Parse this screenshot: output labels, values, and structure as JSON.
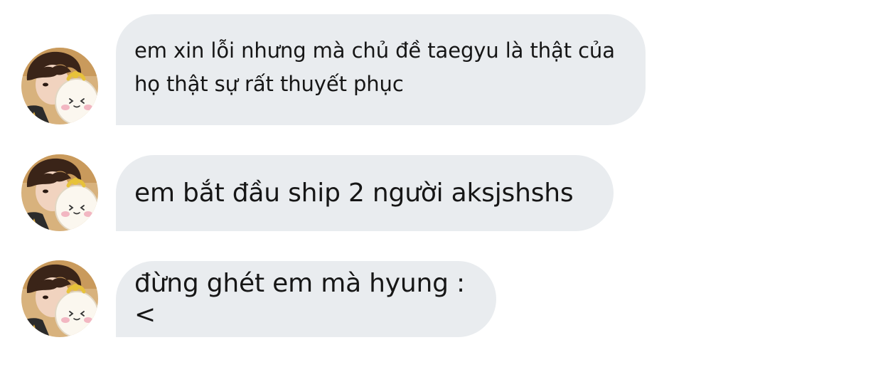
{
  "messages": [
    {
      "text": "em xin lỗi nhưng mà chủ đề taegyu là thật của\nhọ thật sự rất thuyết phục",
      "avatar_icon": "user-avatar-icon"
    },
    {
      "text": "em bắt đầu ship 2 người aksjshshs",
      "avatar_icon": "user-avatar-icon"
    },
    {
      "text": "đừng ghét em mà hyung :<",
      "avatar_icon": "user-avatar-icon"
    }
  ],
  "colors": {
    "bubble_background": "#e9ecef",
    "text": "#161616",
    "page_background": "#ffffff"
  }
}
